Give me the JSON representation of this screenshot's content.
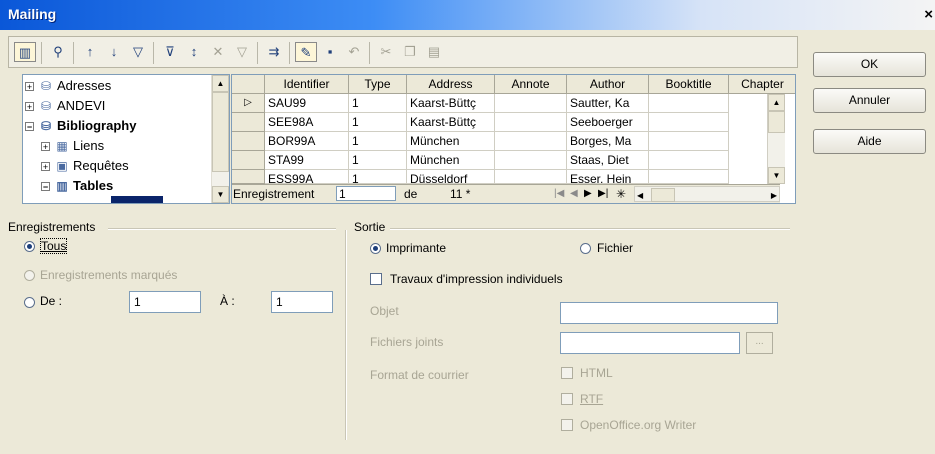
{
  "window": {
    "title": "Mailing",
    "close_glyph": "×"
  },
  "buttons": {
    "ok": "OK",
    "cancel": "Annuler",
    "help": "Aide"
  },
  "toolbar": {
    "icons": [
      "explorer-icon",
      "find-icon",
      "sort-ascending-icon",
      "sort-descending-icon",
      "autofilter-icon",
      "standard-filter-icon",
      "sort-icon",
      "remove-filter-icon",
      "filter-icon",
      "data-to-text-icon",
      "edit-data-icon",
      "save-record-icon",
      "undo-icon",
      "cut-icon",
      "copy-icon",
      "paste-icon"
    ]
  },
  "tree": {
    "items": [
      {
        "expander": "+",
        "label": "Adresses",
        "bold": false
      },
      {
        "expander": "+",
        "label": "ANDEVI",
        "bold": false
      },
      {
        "expander": "−",
        "label": "Bibliography",
        "bold": true
      },
      {
        "expander": "+",
        "label": "Liens",
        "bold": false
      },
      {
        "expander": "+",
        "label": "Requêtes",
        "bold": false
      },
      {
        "expander": "−",
        "label": "Tables",
        "bold": true
      }
    ]
  },
  "grid": {
    "columns": [
      "Identifier",
      "Type",
      "Address",
      "Annote",
      "Author",
      "Booktitle",
      "Chapter"
    ],
    "rows": [
      [
        "SAU99",
        "1",
        "Kaarst-Büttç",
        "",
        "Sautter, Ka",
        "",
        ""
      ],
      [
        "SEE98A",
        "1",
        "Kaarst-Büttç",
        "",
        "Seeboerger",
        "",
        ""
      ],
      [
        "BOR99A",
        "1",
        "München",
        "",
        "Borges, Ma",
        "",
        ""
      ],
      [
        "STA99",
        "1",
        "München",
        "",
        "Staas, Diet",
        "",
        ""
      ],
      [
        "ESS99A",
        "1",
        "Düsseldorf",
        "",
        "Esser, Hein",
        "",
        ""
      ]
    ],
    "current_row_marker": "▷",
    "nav": {
      "label": "Enregistrement",
      "current": "1",
      "of_label": "de",
      "total": "11 *"
    }
  },
  "records": {
    "legend": "Enregistrements",
    "all": "Tous",
    "marked": "Enregistrements marqués",
    "from_label": "De :",
    "from_value": "1",
    "to_label": "À :",
    "to_value": "1"
  },
  "output": {
    "legend": "Sortie",
    "printer": "Imprimante",
    "file": "Fichier",
    "individual_jobs": "Travaux d'impression individuels",
    "subject": "Objet",
    "subject_value": "",
    "attachments": "Fichiers joints",
    "attachments_value": "",
    "mail_format": "Format de courrier",
    "html": "HTML",
    "rtf": "RTF",
    "writer": "OpenOffice.org Writer",
    "browse_glyph": "..."
  }
}
